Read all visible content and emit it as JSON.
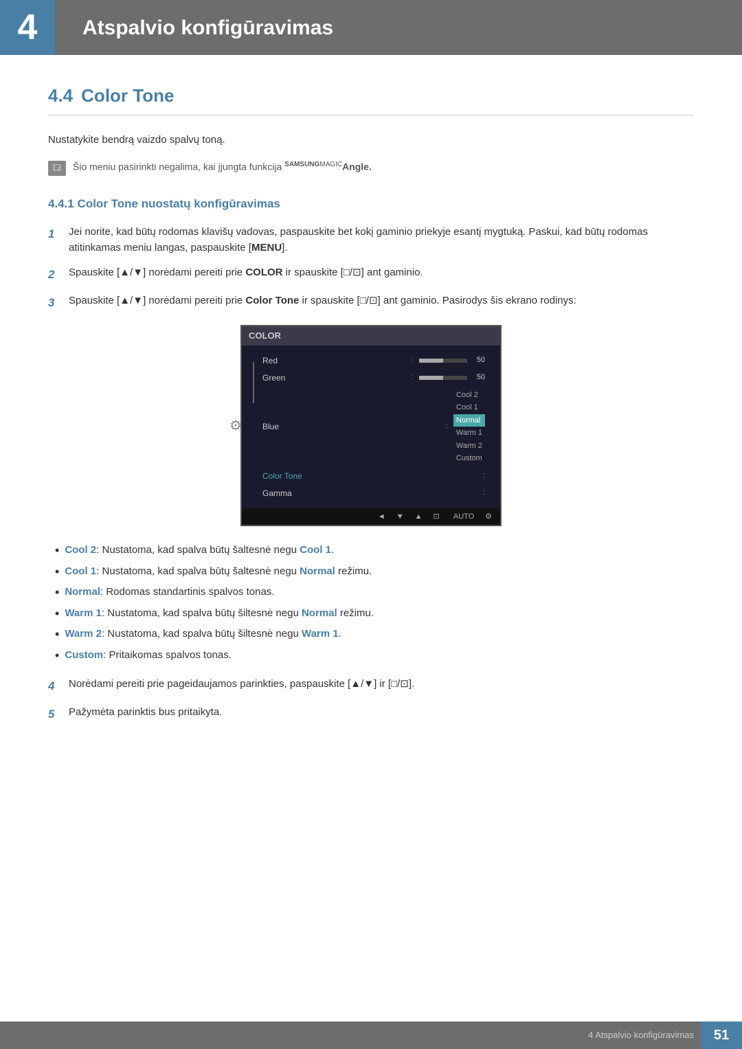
{
  "header": {
    "chapter_number": "4",
    "title": "Atspalvio konfigūravimas"
  },
  "section": {
    "number": "4.4",
    "title": "Color Tone",
    "description": "Nustatykite bendrą vaizdo spalvų toną.",
    "note": "Šio meniu pasirinkti negalima, kai įjungta funkcija",
    "note_brand": "SAMSUNG",
    "note_magic": "MAGIC",
    "note_angle": "Angle."
  },
  "subsection": {
    "number": "4.4.1",
    "title": "Color Tone nuostatų konfigūravimas"
  },
  "steps": [
    {
      "number": "1",
      "text_parts": [
        "Jei norite, kad būtų rodomas klavišų vadovas, paspauskite bet kokį gaminio priekyje esantį mygtuką. Paskui, kad būtų rodomas atitinkamas meniu langas, paspauskite [",
        "MENU",
        "]."
      ]
    },
    {
      "number": "2",
      "text_parts": [
        "Spauskite [▲/▼] norėdami pereiti prie ",
        "COLOR",
        " ir spauskite [□/⊡] ant gaminio."
      ]
    },
    {
      "number": "3",
      "text_parts": [
        "Spauskite [▲/▼] norėdami pereiti prie ",
        "Color Tone",
        " ir spauskite [□/⊡] ant gaminio. Pasirodys šis ekrano rodinys:"
      ]
    }
  ],
  "monitor": {
    "header_label": "COLOR",
    "menu_items": [
      {
        "label": "Red",
        "type": "slider",
        "value": 50
      },
      {
        "label": "Green",
        "type": "slider",
        "value": 50
      },
      {
        "label": "Blue",
        "type": "slider",
        "value": null
      },
      {
        "label": "Color Tone",
        "type": "dropdown",
        "active": true
      },
      {
        "label": "Gamma",
        "type": "dropdown"
      }
    ],
    "dropdown_options": [
      {
        "label": "Cool 2",
        "active": false
      },
      {
        "label": "Cool 1",
        "active": false
      },
      {
        "label": "Normal",
        "active": true
      },
      {
        "label": "Warm 1",
        "active": false
      },
      {
        "label": "Warm 2",
        "active": false
      },
      {
        "label": "Custom",
        "active": false
      }
    ],
    "footer_items": [
      "◄",
      "▼",
      "▲",
      "⊡",
      "AUTO",
      "⚙"
    ]
  },
  "bullet_items": [
    {
      "term": "Cool 2",
      "term_class": "cool",
      "colon": ": Nustatoma, kad spalva būtų šaltesnė negu ",
      "ref_term": "Cool 1",
      "ref_class": "cool",
      "end": "."
    },
    {
      "term": "Cool 1",
      "term_class": "cool",
      "colon": ": Nustatoma, kad spalva būtų šaltesnė negu ",
      "ref_term": "Normal",
      "ref_class": "normal",
      "end": " režimu."
    },
    {
      "term": "Normal",
      "term_class": "normal",
      "colon": ": Rodomas standartinis spalvos tonas.",
      "ref_term": "",
      "ref_class": "",
      "end": ""
    },
    {
      "term": "Warm 1",
      "term_class": "warm",
      "colon": ": Nustatoma, kad spalva būtų šiltesnė negu ",
      "ref_term": "Normal",
      "ref_class": "normal",
      "end": " režimu."
    },
    {
      "term": "Warm 2",
      "term_class": "warm",
      "colon": ": Nustatoma, kad spalva būtų šiltesnė negu ",
      "ref_term": "Warm 1",
      "ref_class": "warm",
      "end": "."
    },
    {
      "term": "Custom",
      "term_class": "custom",
      "colon": ": Pritaikomas spalvos tonas.",
      "ref_term": "",
      "ref_class": "",
      "end": ""
    }
  ],
  "steps_after": [
    {
      "number": "4",
      "text": "Norėdami pereiti prie pageidaujamos parinkties, paspauskite [▲/▼] ir [□/⊡]."
    },
    {
      "number": "5",
      "text": "Pažymėta parinktis bus pritaikyta."
    }
  ],
  "footer": {
    "text": "4 Atspalvio konfigūravimas",
    "page_number": "51"
  }
}
